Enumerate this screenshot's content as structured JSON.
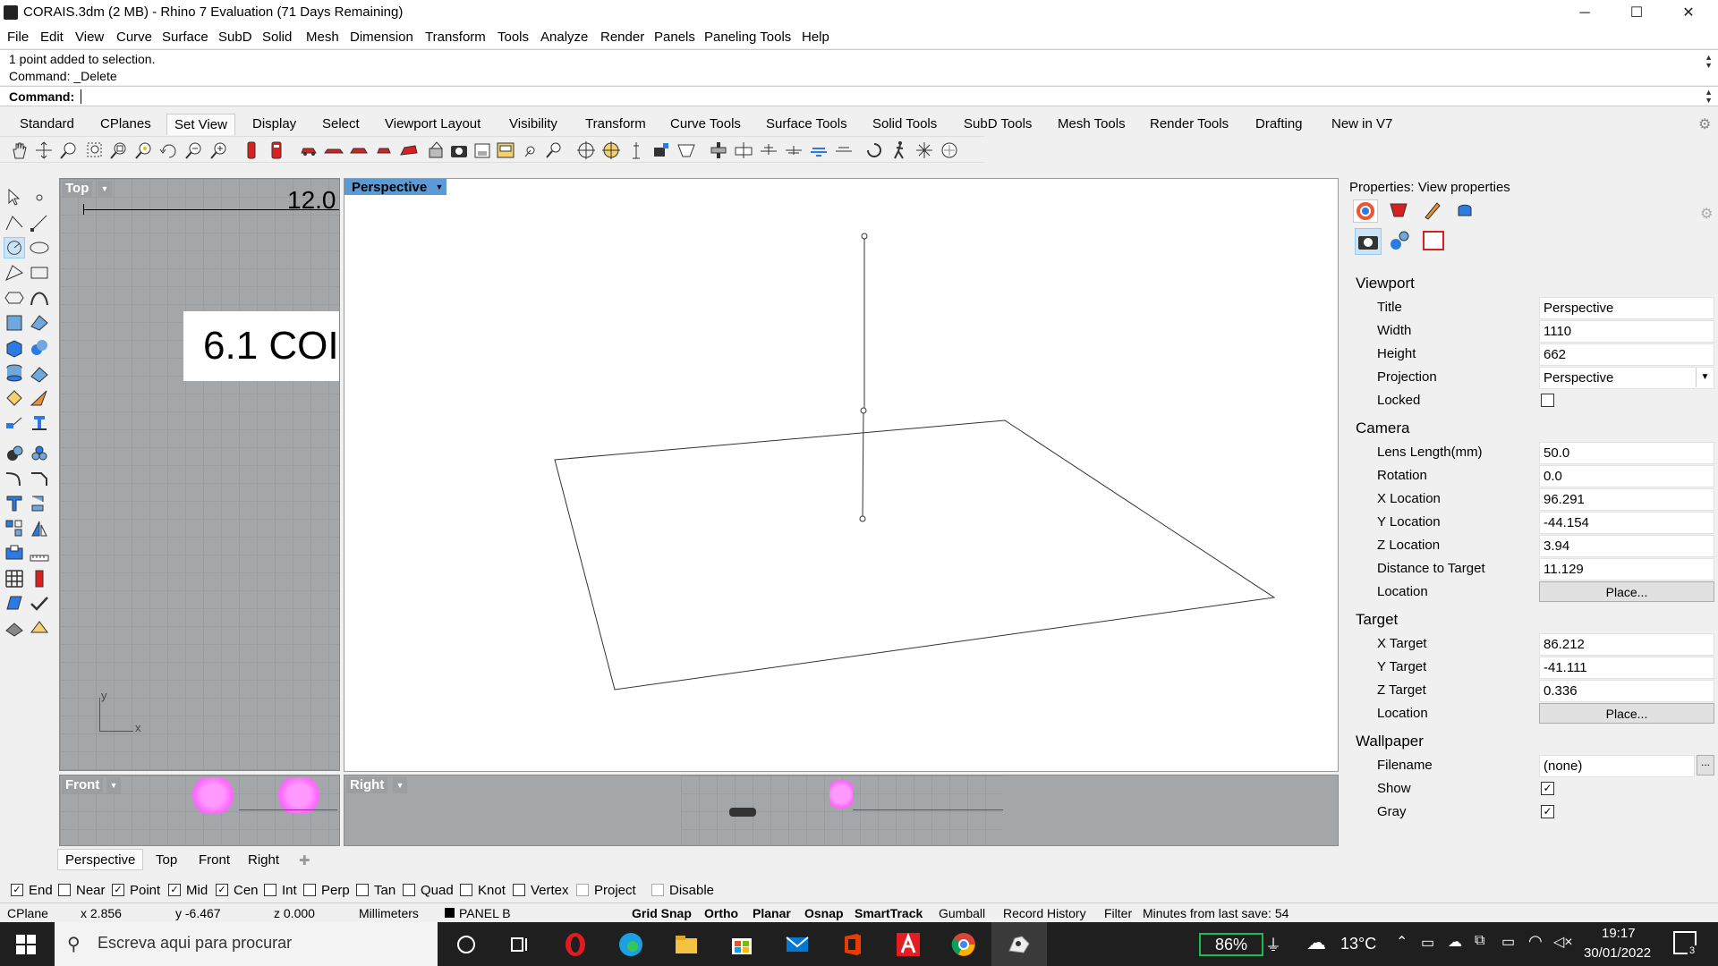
{
  "window": {
    "title": "CORAIS.3dm (2 MB) - Rhino 7 Evaluation (71 Days Remaining)",
    "controls": {
      "minimize": "─",
      "maximize": "☐",
      "close": "✕"
    }
  },
  "menu": [
    "File",
    "Edit",
    "View",
    "Curve",
    "Surface",
    "SubD",
    "Solid",
    "Mesh",
    "Dimension",
    "Transform",
    "Tools",
    "Analyze",
    "Render",
    "Panels",
    "Paneling Tools",
    "Help"
  ],
  "command": {
    "history": [
      "1 point added to selection.",
      "Command: _Delete"
    ],
    "prompt_label": "Command:"
  },
  "toolbar_tabs": [
    "Standard",
    "CPlanes",
    "Set View",
    "Display",
    "Select",
    "Viewport Layout",
    "Visibility",
    "Transform",
    "Curve Tools",
    "Surface Tools",
    "Solid Tools",
    "SubD Tools",
    "Mesh Tools",
    "Render Tools",
    "Drafting",
    "New in V7"
  ],
  "active_toolbar_tab": "Set View",
  "viewports": {
    "top": {
      "title": "Top",
      "ruler_text": "12.0",
      "big_text": "6.1 COI",
      "axis_y": "y",
      "axis_x": "x"
    },
    "perspective": {
      "title": "Perspective"
    },
    "front": {
      "title": "Front"
    },
    "right": {
      "title": "Right"
    }
  },
  "viewport_tabs": [
    "Perspective",
    "Top",
    "Front",
    "Right"
  ],
  "properties": {
    "panel_title": "Properties: View properties",
    "viewport_section": "Viewport",
    "viewport": [
      {
        "key": "Title",
        "value": "Perspective"
      },
      {
        "key": "Width",
        "value": "1110"
      },
      {
        "key": "Height",
        "value": "662"
      },
      {
        "key": "Projection",
        "value": "Perspective"
      },
      {
        "key": "Locked",
        "value": ""
      }
    ],
    "camera_section": "Camera",
    "camera": [
      {
        "key": "Lens Length(mm)",
        "value": "50.0"
      },
      {
        "key": "Rotation",
        "value": "0.0"
      },
      {
        "key": "X Location",
        "value": "96.291"
      },
      {
        "key": "Y Location",
        "value": "-44.154"
      },
      {
        "key": "Z Location",
        "value": "3.94"
      },
      {
        "key": "Distance to Target",
        "value": "11.129"
      },
      {
        "key": "Location",
        "value": "Place..."
      }
    ],
    "target_section": "Target",
    "target": [
      {
        "key": "X Target",
        "value": "86.212"
      },
      {
        "key": "Y Target",
        "value": "-41.111"
      },
      {
        "key": "Z Target",
        "value": "0.336"
      },
      {
        "key": "Location",
        "value": "Place..."
      }
    ],
    "wallpaper_section": "Wallpaper",
    "wallpaper": [
      {
        "key": "Filename",
        "value": "(none)"
      },
      {
        "key": "Show",
        "value": "✓"
      },
      {
        "key": "Gray",
        "value": "✓"
      }
    ],
    "browse_label": "..."
  },
  "osnap": [
    {
      "label": "End",
      "checked": true
    },
    {
      "label": "Near",
      "checked": false
    },
    {
      "label": "Point",
      "checked": true
    },
    {
      "label": "Mid",
      "checked": true
    },
    {
      "label": "Cen",
      "checked": true
    },
    {
      "label": "Int",
      "checked": false
    },
    {
      "label": "Perp",
      "checked": false
    },
    {
      "label": "Tan",
      "checked": false
    },
    {
      "label": "Quad",
      "checked": false
    },
    {
      "label": "Knot",
      "checked": false
    },
    {
      "label": "Vertex",
      "checked": false
    },
    {
      "label": "Project",
      "checked": false
    },
    {
      "label": "Disable",
      "checked": false
    }
  ],
  "status": {
    "cplane": "CPlane",
    "x": "x 2.856",
    "y": "y -6.467",
    "z": "z 0.000",
    "units": "Millimeters",
    "layer": "PANEL B",
    "grid_snap": "Grid Snap",
    "ortho": "Ortho",
    "planar": "Planar",
    "osnap": "Osnap",
    "smarttrack": "SmartTrack",
    "gumball": "Gumball",
    "record_history": "Record History",
    "filter": "Filter",
    "minutes": "Minutes from last save: 54"
  },
  "taskbar": {
    "search_placeholder": "Escreva aqui para procurar",
    "battery": "86%",
    "temperature": "13°C",
    "time": "19:17",
    "date": "30/01/2022",
    "notifications": "3"
  },
  "colors": {
    "accent": "#5b9bd5",
    "viewport_bg": "#a4a7aa",
    "taskbar": "#1f1f1f",
    "selection_pink": "#ff66ff",
    "battery_green": "#1db954"
  }
}
